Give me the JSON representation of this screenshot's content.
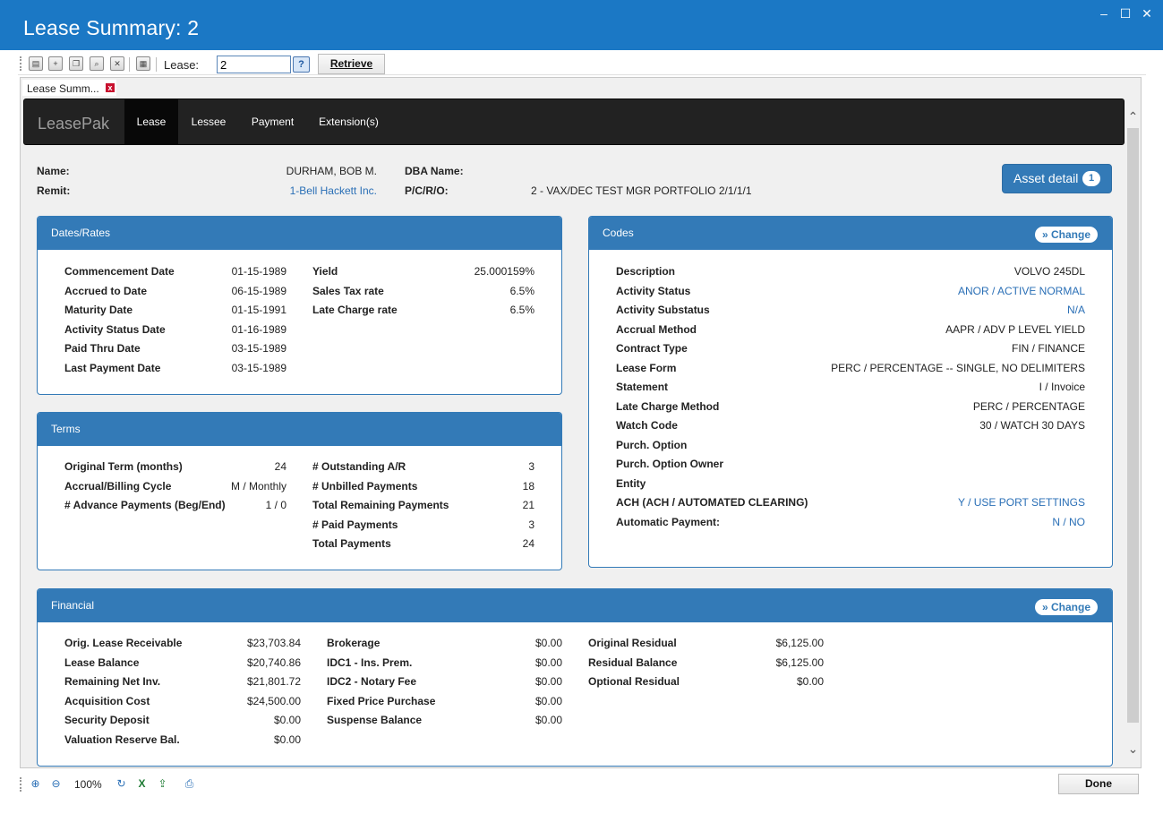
{
  "window": {
    "title": "Lease Summary: 2",
    "minimize": "–",
    "maximize": "☐",
    "close": "✕"
  },
  "toolbar": {
    "lease_label": "Lease:",
    "lease_value": "2",
    "help": "?",
    "retrieve_label": "Retrieve"
  },
  "doc_tab": {
    "label": "Lease Summ...",
    "close": "x"
  },
  "nav": {
    "brand": "LeasePak",
    "items": [
      "Lease",
      "Lessee",
      "Payment",
      "Extension(s)"
    ],
    "active": "Lease"
  },
  "header": {
    "name_label": "Name:",
    "name_value": "DURHAM, BOB M.",
    "remit_label": "Remit:",
    "remit_value": "1-Bell Hackett Inc.",
    "dba_label": "DBA Name:",
    "dba_value": "",
    "pcro_label": "P/C/R/O:",
    "pcro_value": "2 - VAX/DEC TEST MGR PORTFOLIO 2/1/1/1",
    "asset_detail_label": "Asset detail",
    "asset_detail_count": "1"
  },
  "dates_rates": {
    "title": "Dates/Rates",
    "left": [
      {
        "k": "Commencement Date",
        "v": "01-15-1989"
      },
      {
        "k": "Accrued to Date",
        "v": "06-15-1989"
      },
      {
        "k": "Maturity Date",
        "v": "01-15-1991"
      },
      {
        "k": "Activity Status Date",
        "v": "01-16-1989"
      },
      {
        "k": "Paid Thru Date",
        "v": "03-15-1989"
      },
      {
        "k": "Last Payment Date",
        "v": "03-15-1989"
      }
    ],
    "right": [
      {
        "k": "Yield",
        "v": "25.000159%"
      },
      {
        "k": "Sales Tax rate",
        "v": "6.5%"
      },
      {
        "k": "Late Charge rate",
        "v": "6.5%"
      }
    ]
  },
  "terms": {
    "title": "Terms",
    "left": [
      {
        "k": "Original Term (months)",
        "v": "24"
      },
      {
        "k": "Accrual/Billing Cycle",
        "v": "M / Monthly"
      },
      {
        "k": "# Advance Payments (Beg/End)",
        "v": "1 / 0"
      }
    ],
    "right": [
      {
        "k": "# Outstanding A/R",
        "v": "3"
      },
      {
        "k": "# Unbilled Payments",
        "v": "18"
      },
      {
        "k": "Total Remaining Payments",
        "v": "21"
      },
      {
        "k": "# Paid Payments",
        "v": "3"
      },
      {
        "k": "Total Payments",
        "v": "24"
      }
    ]
  },
  "codes": {
    "title": "Codes",
    "change_label": "Change",
    "rows": [
      {
        "k": "Description",
        "v": "VOLVO 245DL",
        "link": false
      },
      {
        "k": "Activity Status",
        "v": "ANOR / ACTIVE NORMAL",
        "link": true
      },
      {
        "k": "Activity Substatus",
        "v": "N/A",
        "link": true
      },
      {
        "k": "Accrual Method",
        "v": "AAPR / ADV P LEVEL YIELD",
        "link": false
      },
      {
        "k": "Contract Type",
        "v": "FIN / FINANCE",
        "link": false
      },
      {
        "k": "Lease Form",
        "v": "PERC / PERCENTAGE -- SINGLE, NO DELIMITERS",
        "link": false
      },
      {
        "k": "Statement",
        "v": "I / Invoice",
        "link": false
      },
      {
        "k": "Late Charge Method",
        "v": "PERC / PERCENTAGE",
        "link": false
      },
      {
        "k": "Watch Code",
        "v": "30 / WATCH 30 DAYS",
        "link": false
      },
      {
        "k": "Purch. Option",
        "v": "",
        "link": false
      },
      {
        "k": "Purch. Option Owner",
        "v": "",
        "link": false
      },
      {
        "k": "Entity",
        "v": "",
        "link": false
      },
      {
        "k": "ACH (ACH / AUTOMATED CLEARING)",
        "v": "Y / USE PORT SETTINGS",
        "link": true
      },
      {
        "k": "Automatic Payment:",
        "v": "N / NO",
        "link": true
      }
    ]
  },
  "financial": {
    "title": "Financial",
    "change_label": "Change",
    "col1": [
      {
        "k": "Orig. Lease Receivable",
        "v": "$23,703.84"
      },
      {
        "k": "Lease Balance",
        "v": "$20,740.86"
      },
      {
        "k": "Remaining Net Inv.",
        "v": "$21,801.72"
      },
      {
        "k": "Acquisition Cost",
        "v": "$24,500.00"
      },
      {
        "k": "Security Deposit",
        "v": "$0.00"
      },
      {
        "k": "Valuation Reserve Bal.",
        "v": "$0.00"
      }
    ],
    "col2": [
      {
        "k": "Brokerage",
        "v": "$0.00"
      },
      {
        "k": "IDC1 - Ins. Prem.",
        "v": "$0.00"
      },
      {
        "k": "IDC2 - Notary Fee",
        "v": "$0.00"
      },
      {
        "k": "Fixed Price Purchase",
        "v": "$0.00"
      },
      {
        "k": "Suspense Balance",
        "v": "$0.00"
      }
    ],
    "col3": [
      {
        "k": "Original Residual",
        "v": "$6,125.00"
      },
      {
        "k": "Residual Balance",
        "v": "$6,125.00"
      },
      {
        "k": "Optional Residual",
        "v": "$0.00"
      }
    ]
  },
  "statusbar": {
    "zoom": "100%",
    "done_label": "Done"
  }
}
